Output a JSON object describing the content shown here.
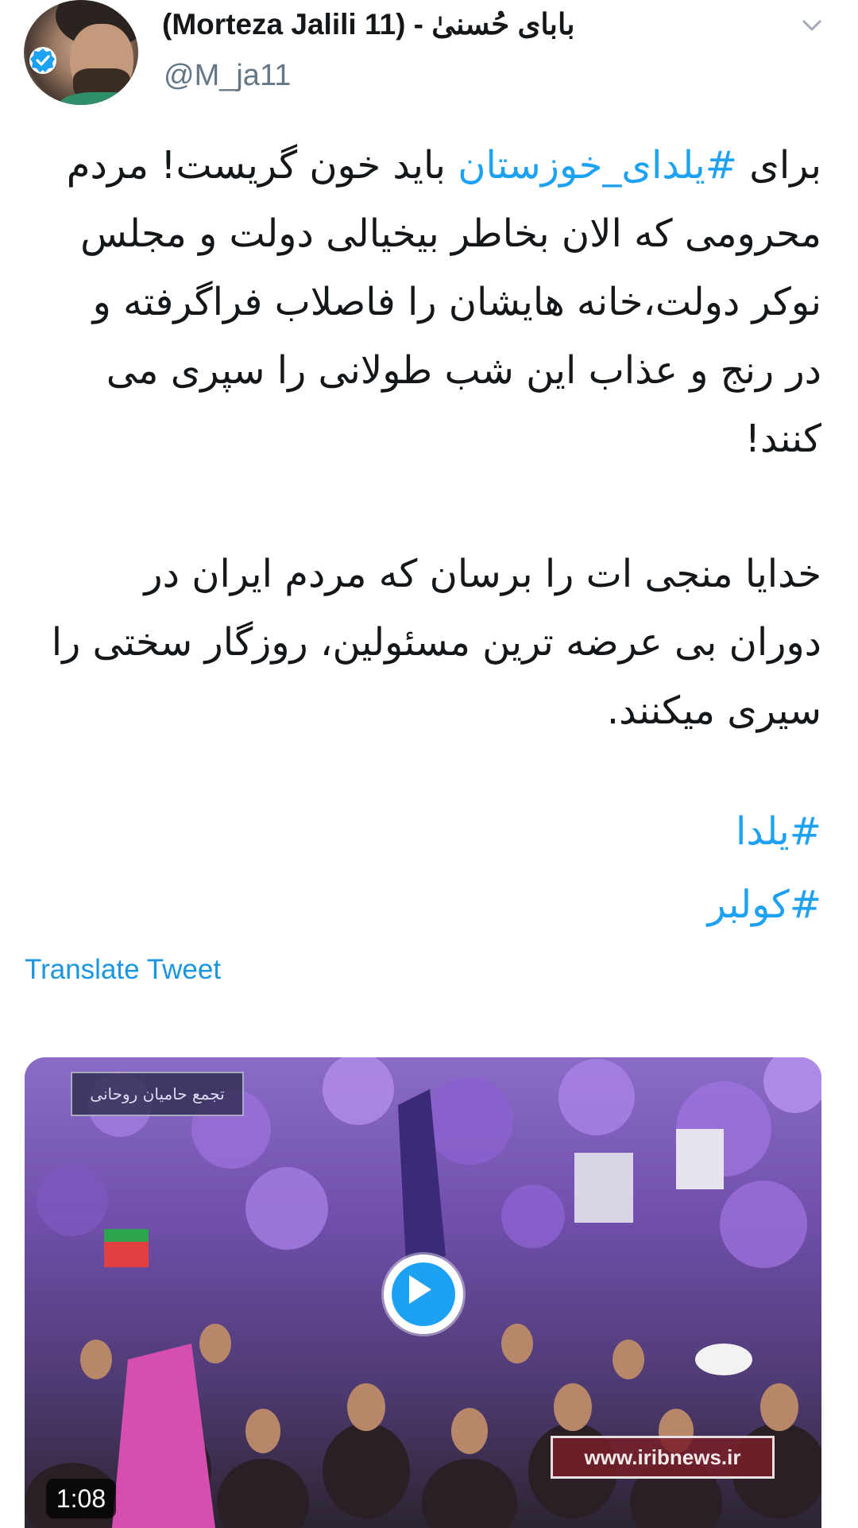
{
  "header": {
    "display_name": "بابای حُسنیٰ - (Morteza Jalili 11)",
    "handle": "@M_ja11",
    "icons": [
      "avatar",
      "verified-badge-icon",
      "chevron-down-icon"
    ]
  },
  "tweet": {
    "paragraph1": {
      "prefix": "برای ",
      "hashtag": "#یلدای_خوزستان",
      "suffix": " باید خون گریست! مردم محرومی که الان بخاطر بیخیالی دولت و مجلس نوکر دولت،خانه هایشان را فاصلاب فراگرفته و در رنج و عذاب این شب طولانی را سپری می کنند!"
    },
    "paragraph2": "خدایا منجی ات را برسان که مردم ایران در دوران بی عرضه ترین مسئولین، روزگار سختی را سیری میکنند.",
    "hashtags": [
      "#یلدا",
      "#کولبر"
    ],
    "translate_label": "Translate Tweet"
  },
  "media": {
    "type": "video",
    "duration": "1:08",
    "caption_overlay": "تجمع حامیان روحانی",
    "channel_watermark": "www.iribnews.ir",
    "icons": [
      "play-icon"
    ],
    "colors": {
      "play_accent": "#1da1f2",
      "crowd_tint": "#7a55b8"
    }
  },
  "colors": {
    "link": "#1da1f2",
    "text": "#14171a",
    "secondary": "#657786"
  }
}
